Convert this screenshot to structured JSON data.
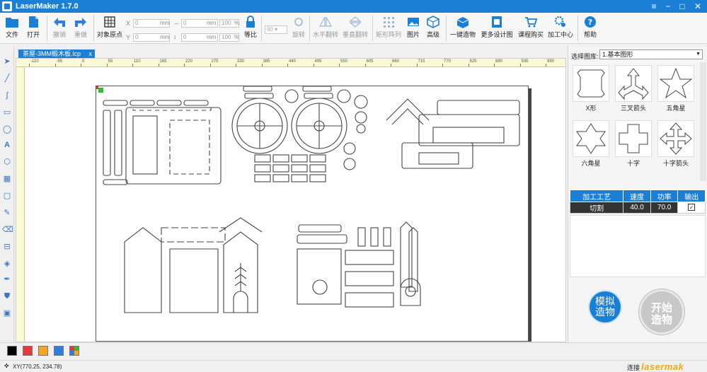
{
  "app": {
    "title": "LaserMaker 1.7.0"
  },
  "window_buttons": {
    "menu": "≡",
    "minimize": "−",
    "restore": "□",
    "close": "✕"
  },
  "toolbar": {
    "file": "文件",
    "open": "打开",
    "undo": "撤销",
    "redo": "重做",
    "object_origin": "对象原点",
    "x_label": "X",
    "y_label": "Y",
    "x_value": "0",
    "y_value": "0",
    "unit_mm": "mm",
    "w_value": "0",
    "h_value": "0",
    "pct_w": "100",
    "pct_h": "100",
    "pct": "%",
    "proportional": "等比",
    "angle_value": "90",
    "rotate": "旋转",
    "flip_h": "水平翻转",
    "flip_v": "垂直翻转",
    "array": "矩形阵列",
    "image": "图片",
    "advanced": "高级",
    "one_click": "一键造物",
    "more_designs": "更多设计图",
    "courses": "课程购买",
    "processing_center": "加工中心",
    "help": "帮助"
  },
  "document": {
    "tab_name": "茶屋-3MM椴木板.lcp",
    "close": "x"
  },
  "ruler": {
    "labels": [
      "-110",
      "-55",
      "0",
      "55",
      "110",
      "165",
      "220",
      "275",
      "330",
      "385",
      "440",
      "495",
      "550",
      "605",
      "660",
      "715",
      "770",
      "825",
      "880",
      "935",
      "990"
    ]
  },
  "library": {
    "label": "选择图库:",
    "selected": "1.基本图形",
    "shapes": [
      {
        "name": "X形",
        "icon": "x-shape-icon"
      },
      {
        "name": "三叉箭头",
        "icon": "three-way-arrow-icon"
      },
      {
        "name": "五角星",
        "icon": "five-point-star-icon"
      },
      {
        "name": "六角星",
        "icon": "six-point-star-icon"
      },
      {
        "name": "十字",
        "icon": "cross-icon"
      },
      {
        "name": "十字箭头",
        "icon": "cross-arrow-icon"
      }
    ]
  },
  "layers": {
    "headers": [
      "加工工艺",
      "速度",
      "功率",
      "输出"
    ],
    "rows": [
      {
        "process": "切割",
        "speed": "40.0",
        "power": "70.0",
        "output": "✓"
      }
    ]
  },
  "buttons": {
    "simulate": "模拟\n造物",
    "simulate_l1": "模拟",
    "simulate_l2": "造物",
    "start_l1": "开始",
    "start_l2": "造物"
  },
  "colors": {
    "swatches": [
      "#000000",
      "#e8393b",
      "#f5a623",
      "#2f7de1",
      "multi"
    ],
    "accent": "#1c7fd6"
  },
  "status": {
    "coords": "XY(770.25, 234.78)",
    "connection": "连接",
    "watermark": "lasermak"
  }
}
